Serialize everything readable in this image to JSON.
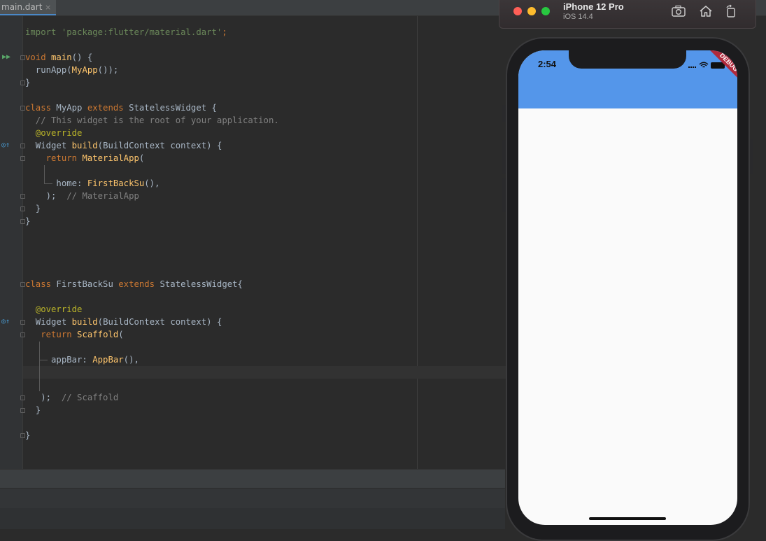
{
  "editor": {
    "tab_label": "main.dart",
    "tab_close": "×",
    "lines": {
      "l1": {
        "a": "import ",
        "b": "'package:flutter/material.dart'",
        "c": ";"
      },
      "l2": {
        "a": "void ",
        "b": "main",
        "c": "() {"
      },
      "l3": {
        "a": "  runApp(",
        "b": "MyApp",
        "c": "());"
      },
      "l4": {
        "a": "}"
      },
      "l5": {
        "a": "class ",
        "b": "MyApp ",
        "c": "extends ",
        "d": "StatelessWidget {"
      },
      "l6": {
        "a": "  // This widget is the root of your application."
      },
      "l7": {
        "a": "  @override"
      },
      "l8": {
        "a": "  Widget ",
        "b": "build",
        "c": "(BuildContext context) {"
      },
      "l9": {
        "a": "    return ",
        "b": "MaterialApp",
        "c": "("
      },
      "l10": {
        "a": "      home: ",
        "b": "FirstBackSu",
        "c": "(),"
      },
      "l11": {
        "a": "    );  ",
        "b": "// MaterialApp"
      },
      "l12": {
        "a": "  }"
      },
      "l13": {
        "a": "}"
      },
      "l14": {
        "a": "class ",
        "b": "FirstBackSu ",
        "c": "extends ",
        "d": "StatelessWidget{"
      },
      "l15": {
        "a": "  @override"
      },
      "l16": {
        "a": "  Widget ",
        "b": "build",
        "c": "(BuildContext context) {"
      },
      "l17": {
        "a": "   return ",
        "b": "Scaffold",
        "c": "("
      },
      "l18": {
        "a": "     appBar: ",
        "b": "AppBar",
        "c": "(),"
      },
      "l19": {
        "a": "   );  ",
        "b": "// Scaffold"
      },
      "l20": {
        "a": "  }"
      },
      "l21": {
        "a": "}"
      }
    }
  },
  "simulator": {
    "device_name": "iPhone 12 Pro",
    "os_version": "iOS 14.4",
    "status_time": "2:54",
    "debug_banner": "DEBUG",
    "appbar_color": "#5496ea",
    "buttons": [
      "screenshot-icon",
      "home-icon",
      "rotate-icon"
    ]
  }
}
